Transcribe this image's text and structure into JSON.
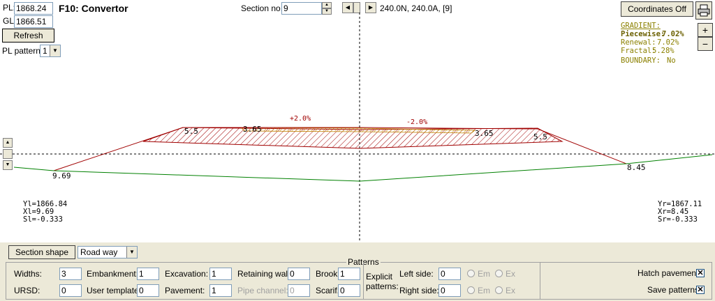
{
  "header": {
    "pl_label": "PL:",
    "pl_value": "1868.24",
    "gl_label": "GL:",
    "gl_value": "1866.51",
    "title": "F10: Convertor",
    "refresh_label": "Refresh",
    "pl_pattern_label": "PL pattern:",
    "pl_pattern_value": "1",
    "section_no_label": "Section no.:",
    "section_no_value": "9",
    "nav_info": "240.0N, 240.0A, [9]",
    "coordinates_button": "Coordinates Off",
    "zoom_in": "+",
    "zoom_out": "−"
  },
  "gradient": {
    "title": "GRADIENT:",
    "piecewise_label": "Piecewise:",
    "piecewise_value": "7.02%",
    "renewal_label": "Renewal:",
    "renewal_value": "7.02%",
    "fractal_label": "Fractal:",
    "fractal_value": "5.28%",
    "boundary_label": "BOUNDARY:",
    "boundary_value": "No"
  },
  "drawing": {
    "slope_left": "+2.0%",
    "slope_right": "-2.0%",
    "left_shoulder": "5.5",
    "left_inner": "3.65",
    "right_inner": "3.65",
    "right_shoulder": "5.5",
    "left_toe": "9.69",
    "right_toe": "8.45",
    "left_info": [
      "Yl=1866.84",
      "Xl=9.69",
      "Sl=-0.333"
    ],
    "right_info": [
      "Yr=1867.11",
      "Xr=8.45",
      "Sr=-0.333"
    ],
    "colors": {
      "embankment": "#a00000",
      "ground": "#008000",
      "hatch": "#c08000",
      "labels": "#a00000"
    }
  },
  "bottom": {
    "section_shape_label": "Section shape",
    "section_shape_value": "Road way",
    "patterns_title": "Patterns",
    "widths_label": "Widths:",
    "widths_value": "3",
    "ursd_label": "URSD:",
    "ursd_value": "0",
    "embankment_label": "Embankment:",
    "embankment_value": "1",
    "user_template_label": "User template:",
    "user_template_value": "0",
    "excavation_label": "Excavation:",
    "excavation_value": "1",
    "pavement_label": "Pavement:",
    "pavement_value": "1",
    "retaining_wall_label": "Retaining wall:",
    "retaining_wall_value": "0",
    "pipe_channel_label": "Pipe channel:",
    "pipe_channel_value": "0",
    "brook_label": "Brook:",
    "brook_value": "1",
    "scarif_label": "Scarif.:",
    "scarif_value": "0",
    "explicit_label_1": "Explicit",
    "explicit_label_2": "patterns:",
    "left_side_label": "Left side:",
    "left_side_value": "0",
    "right_side_label": "Right side:",
    "right_side_value": "0",
    "em_label": "Em",
    "ex_label": "Ex",
    "hatch_pavement_label": "Hatch pavement",
    "save_patterns_label": "Save patterns",
    "check_mark": "✕"
  }
}
